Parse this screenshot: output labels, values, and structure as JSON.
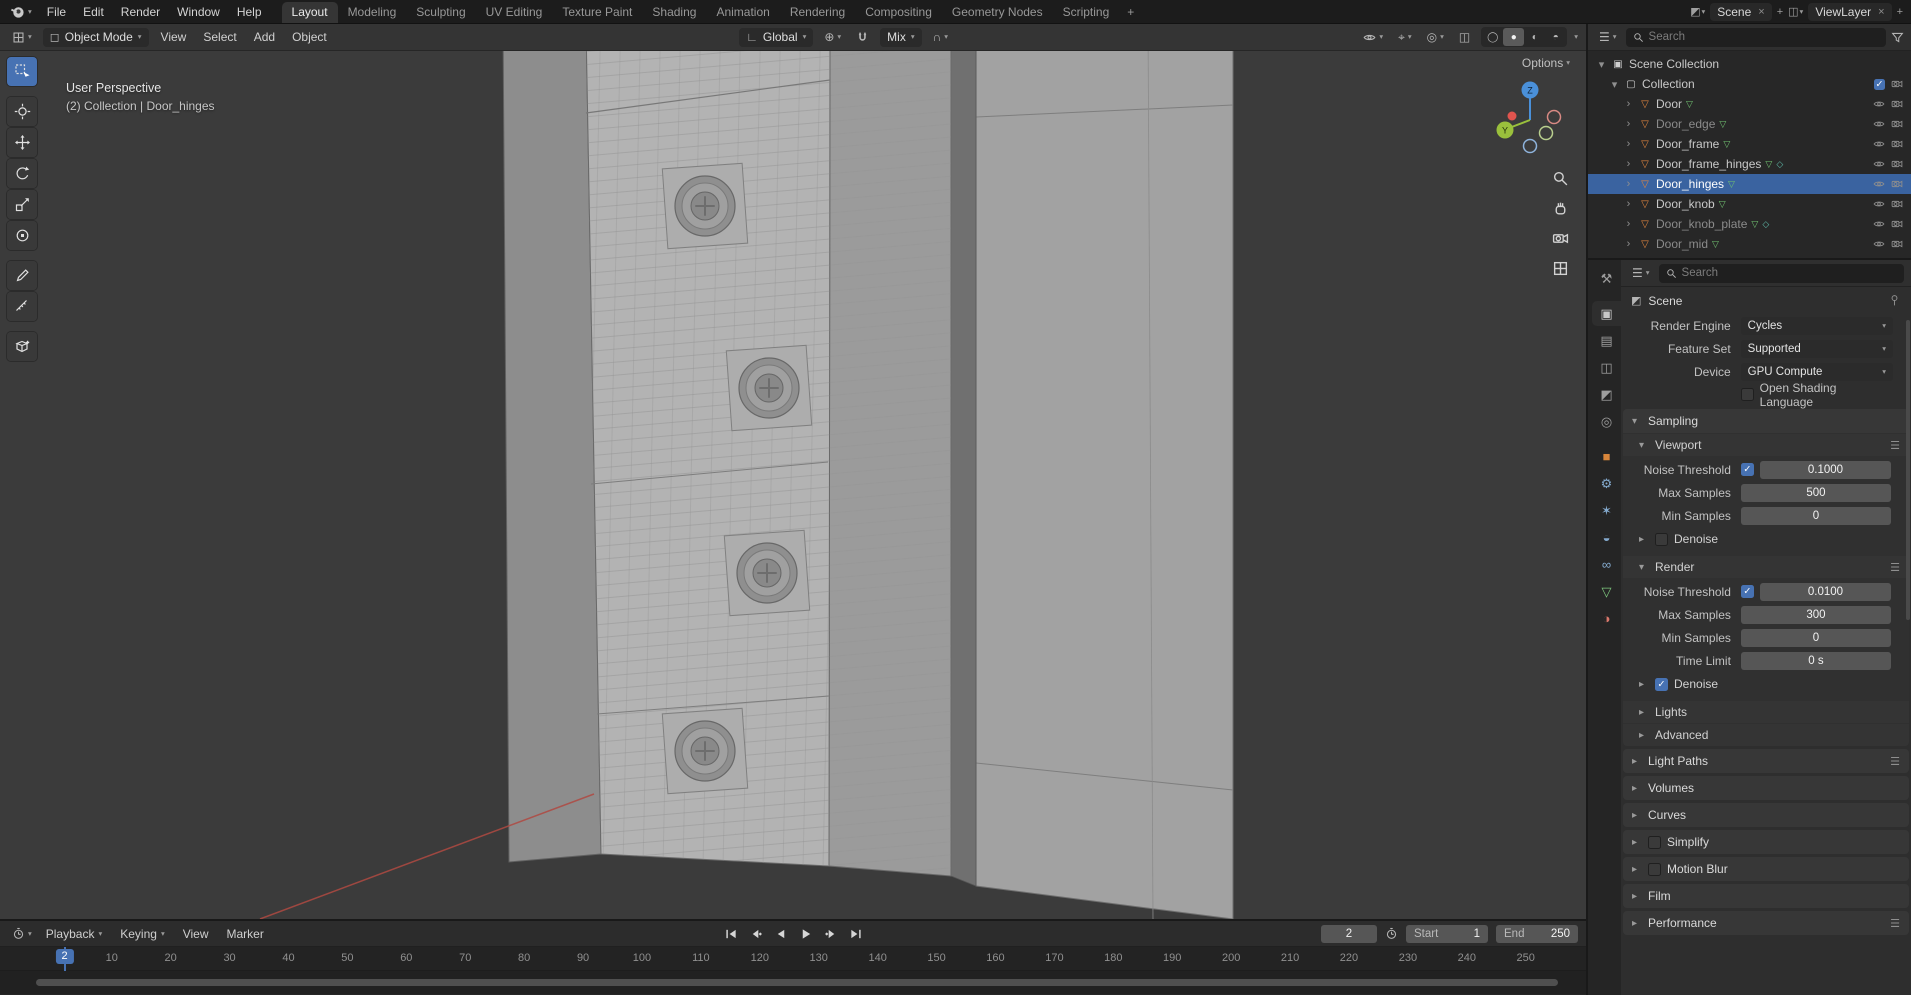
{
  "colors": {
    "accent": "#4772b3",
    "selected_row": "#3a63a0",
    "object_icon": "#e0853f",
    "data_icon": "#71c171",
    "axis_x": "#e0544e",
    "axis_y": "#9ac03c",
    "axis_z": "#4a90d9"
  },
  "icons": {
    "dropdown_arrow": "▾",
    "panel_open": "▾",
    "panel_closed": "▸",
    "tree_closed": "›",
    "tree_open": "▾",
    "check": "✓",
    "close": "×",
    "plus": "+",
    "mesh_object": "▽",
    "badge_data": "▽",
    "badge_mod": "◇",
    "collection": "▢",
    "scene_collection": "▣",
    "presets": "☰",
    "orientation": "∟",
    "pivot": "⊕",
    "proportional": "∩",
    "xray": "◫",
    "overlays": "◎",
    "gizmo": "⌖",
    "shading_wire": "◯",
    "shading_solid": "●",
    "shading_material": "◐",
    "shading_rendered": "◓",
    "mode_cube": "◻",
    "scene_icon": "◩",
    "viewlayer_icon": "◫",
    "editor_list": "☰"
  },
  "topbar": {
    "menus": [
      "File",
      "Edit",
      "Render",
      "Window",
      "Help"
    ],
    "workspaces": [
      "Layout",
      "Modeling",
      "Sculpting",
      "UV Editing",
      "Texture Paint",
      "Shading",
      "Animation",
      "Rendering",
      "Compositing",
      "Geometry Nodes",
      "Scripting"
    ],
    "add_workspace_label": "+",
    "scene_name": "Scene",
    "view_layer_name": "ViewLayer"
  },
  "viewport": {
    "mode": "Object Mode",
    "menus": [
      "View",
      "Select",
      "Add",
      "Object"
    ],
    "orientation": "Global",
    "falloff": "Mix",
    "options_label": "Options",
    "overlay_line1": "User Perspective",
    "overlay_line2": "(2) Collection | Door_hinges",
    "gizmo_z": "Z",
    "gizmo_y": "Y"
  },
  "outliner": {
    "search_placeholder": "Search",
    "scene_collection_label": "Scene Collection",
    "collection_label": "Collection",
    "items": [
      {
        "name": "Door",
        "badges": 1
      },
      {
        "name": "Door_edge",
        "badges": 1,
        "dim": true
      },
      {
        "name": "Door_frame",
        "badges": 1
      },
      {
        "name": "Door_frame_hinges",
        "badges": 2
      },
      {
        "name": "Door_hinges",
        "badges": 1,
        "selected": true
      },
      {
        "name": "Door_knob",
        "badges": 1
      },
      {
        "name": "Door_knob_plate",
        "badges": 2,
        "dim": true
      },
      {
        "name": "Door_mid",
        "badges": 1,
        "dim": true
      }
    ]
  },
  "properties": {
    "search_placeholder": "Search",
    "breadcrumb": "Scene",
    "tabs": [
      {
        "name": "tool",
        "glyph": "⚒"
      },
      {
        "name": "render",
        "glyph": "▣",
        "active": true
      },
      {
        "name": "output",
        "glyph": "▤"
      },
      {
        "name": "view-layer",
        "glyph": "◫"
      },
      {
        "name": "scene",
        "glyph": "◩"
      },
      {
        "name": "world",
        "glyph": "◎"
      },
      {
        "name": "object",
        "glyph": "■"
      },
      {
        "name": "modifiers",
        "glyph": "⚙"
      },
      {
        "name": "particles",
        "glyph": "✶"
      },
      {
        "name": "physics",
        "glyph": "◒"
      },
      {
        "name": "constraints",
        "glyph": "∞"
      },
      {
        "name": "object-data",
        "glyph": "▽"
      },
      {
        "name": "material",
        "glyph": "◑"
      }
    ],
    "render_engine_label": "Render Engine",
    "render_engine": "Cycles",
    "feature_set_label": "Feature Set",
    "feature_set": "Supported",
    "device_label": "Device",
    "device": "GPU Compute",
    "osl_label": "Open Shading Language",
    "sampling": {
      "title": "Sampling",
      "viewport_title": "Viewport",
      "render_title": "Render",
      "noise_threshold_label": "Noise Threshold",
      "max_samples_label": "Max Samples",
      "min_samples_label": "Min Samples",
      "time_limit_label": "Time Limit",
      "denoise_label": "Denoise",
      "lights_label": "Lights",
      "advanced_label": "Advanced",
      "viewport_noise_threshold": "0.1000",
      "viewport_max_samples": "500",
      "viewport_min_samples": "0",
      "render_noise_threshold": "0.0100",
      "render_max_samples": "300",
      "render_min_samples": "0",
      "render_time_limit": "0 s"
    },
    "panels": [
      "Light Paths",
      "Volumes",
      "Curves",
      "Simplify",
      "Motion Blur",
      "Film",
      "Performance"
    ]
  },
  "timeline": {
    "menus": [
      "Playback",
      "Keying",
      "View",
      "Marker"
    ],
    "current_frame": "2",
    "start_label": "Start",
    "start_value": "1",
    "end_label": "End",
    "end_value": "250",
    "ticks": [
      10,
      20,
      30,
      40,
      50,
      60,
      70,
      80,
      90,
      100,
      110,
      120,
      130,
      140,
      150,
      160,
      170,
      180,
      190,
      200,
      210,
      220,
      230,
      240,
      250
    ]
  }
}
